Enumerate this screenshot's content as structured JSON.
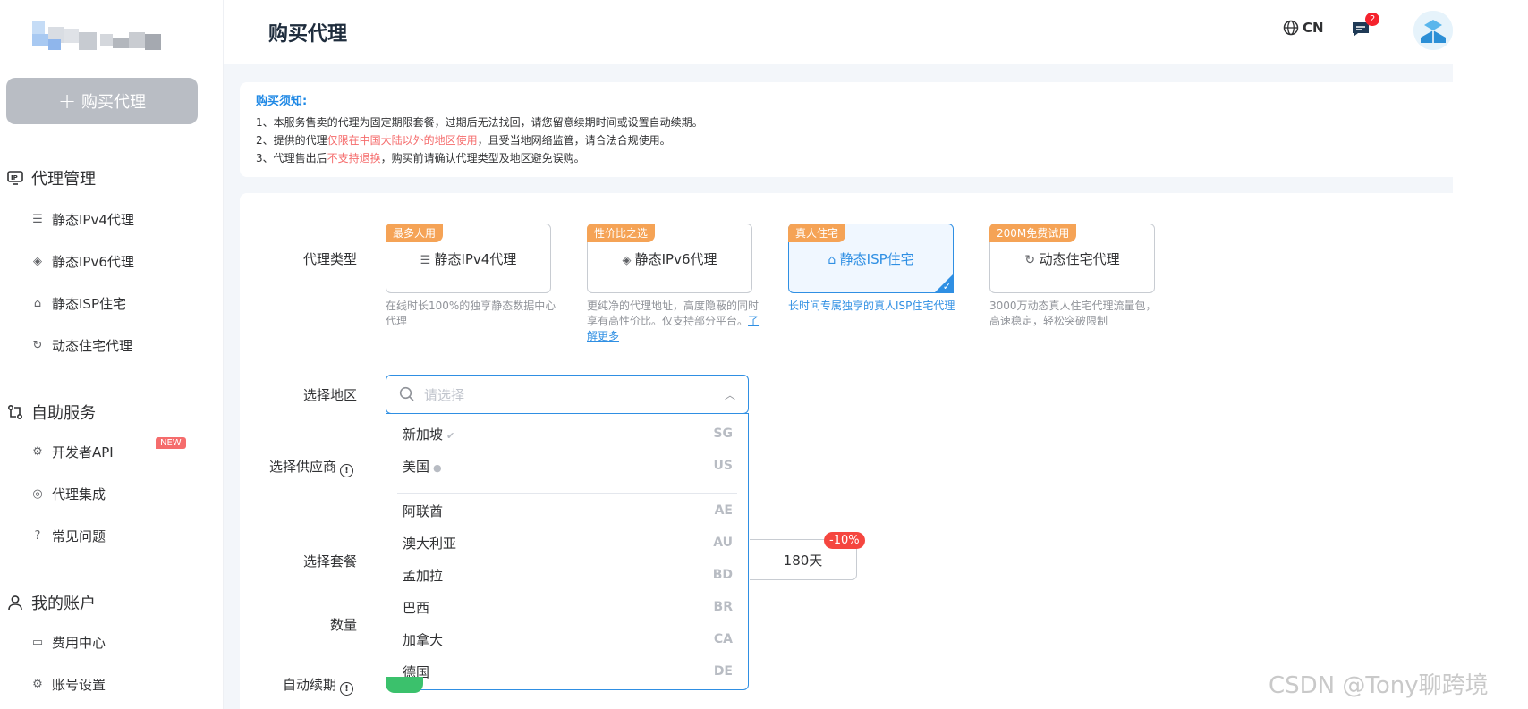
{
  "sidebar": {
    "buy_button": "购买代理",
    "sections": [
      {
        "label": "代理管理",
        "items": [
          "静态IPv4代理",
          "静态IPv6代理",
          "静态ISP住宅",
          "动态住宅代理"
        ]
      },
      {
        "label": "自助服务",
        "items": [
          "开发者API",
          "代理集成",
          "常见问题"
        ],
        "badge": "NEW"
      },
      {
        "label": "我的账户",
        "items": [
          "费用中心",
          "账号设置"
        ]
      }
    ]
  },
  "header": {
    "title": "购买代理",
    "lang": "CN",
    "message_count": "2"
  },
  "notice": {
    "title": "购买须知:",
    "line1": "1、本服务售卖的代理为固定期限套餐，过期后无法找回，请您留意续期时间或设置自动续期。",
    "line2_pre": "2、提供的代理",
    "line2_red": "仅限在中国大陆以外的地区使用",
    "line2_post": "，且受当地网络监管，请合法合规使用。",
    "line3_pre": "3、代理售出后",
    "line3_red": "不支持退换",
    "line3_post": "，购买前请确认代理类型及地区避免误购。"
  },
  "form": {
    "proxy_type_label": "代理类型",
    "region_label": "选择地区",
    "supplier_label": "选择供应商",
    "package_label": "选择套餐",
    "quantity_label": "数量",
    "auto_renew_label": "自动续期",
    "types": [
      {
        "tag": "最多人用",
        "name": "静态IPv4代理",
        "desc": "在线时长100%的独享静态数据中心代理",
        "selected": false
      },
      {
        "tag": "性价比之选",
        "name": "静态IPv6代理",
        "desc": "更纯净的代理地址，高度隐蔽的同时享有高性价比。仅支持部分平台。",
        "link": "了解更多",
        "selected": false
      },
      {
        "tag": "真人住宅",
        "name": "静态ISP住宅",
        "desc": "长时间专属独享的真人ISP住宅代理",
        "selected": true
      },
      {
        "tag": "200M免费试用",
        "name": "动态住宅代理",
        "desc": "3000万动态真人住宅代理流量包，高速稳定，轻松突破限制",
        "selected": false
      }
    ],
    "region_placeholder": "请选择",
    "region_options": [
      {
        "name": "新加坡",
        "code": "SG"
      },
      {
        "name": "美国",
        "code": "US"
      },
      {
        "name": "阿联酋",
        "code": "AE"
      },
      {
        "name": "澳大利亚",
        "code": "AU"
      },
      {
        "name": "孟加拉",
        "code": "BD"
      },
      {
        "name": "巴西",
        "code": "BR"
      },
      {
        "name": "加拿大",
        "code": "CA"
      },
      {
        "name": "德国",
        "code": "DE"
      }
    ],
    "package_value": "180天",
    "package_discount": "-10%"
  },
  "watermark": "CSDN @Tony聊跨境",
  "colors": {
    "primary": "#2f8fe3",
    "tag": "#f5a356",
    "danger": "#f56c6c"
  }
}
